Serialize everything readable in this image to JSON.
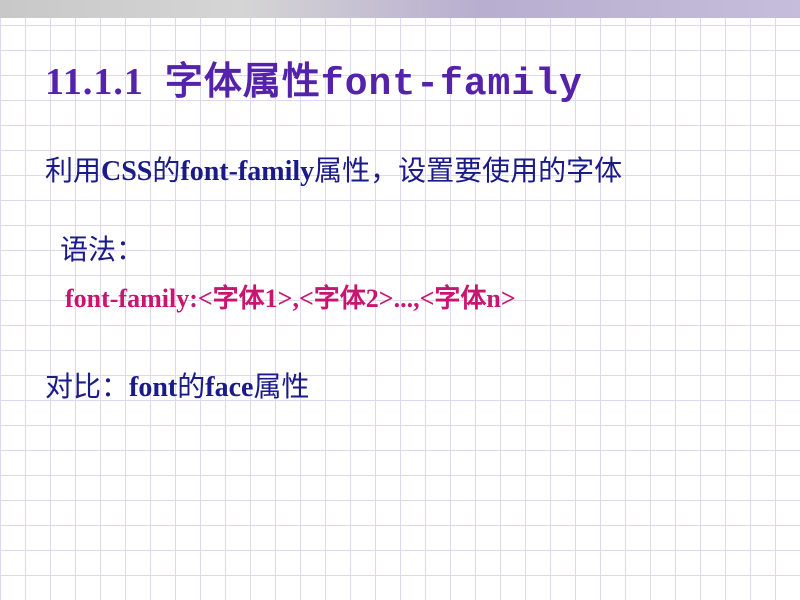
{
  "title": {
    "number": "11.1.1",
    "text_cn": "字体属性",
    "text_code": "font-family"
  },
  "intro": {
    "part1": "利用",
    "css": "CSS",
    "part2": "的",
    "prop": "font-family",
    "part3": "属性，设置要使用的字体"
  },
  "syntax": {
    "label": "语法：",
    "code": "font-family:<字体1>,<字体2>...,<字体n>"
  },
  "compare": {
    "label": "对比：",
    "font": "font",
    "mid": "的",
    "face": "face",
    "suffix": "属性"
  }
}
